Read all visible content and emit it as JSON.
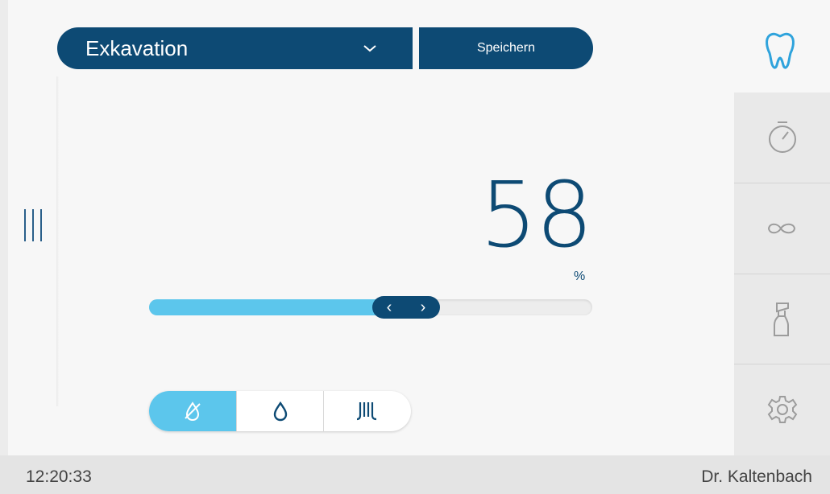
{
  "program": {
    "label": "Exkavation"
  },
  "toolbar": {
    "save_label": "Speichern"
  },
  "motor": {
    "speed_value": "58",
    "speed_unit": "%",
    "speed_fraction": 0.58
  },
  "coolant": {
    "options": [
      "spray-off",
      "water-drop",
      "spray-jets"
    ],
    "selected": "spray-off"
  },
  "sidebar": {
    "items": [
      "stopwatch-icon",
      "infinity-icon",
      "spray-bottle-icon",
      "gear-icon"
    ]
  },
  "status": {
    "time": "12:20:33",
    "user": "Dr. Kaltenbach"
  },
  "colors": {
    "primary": "#0d4a74",
    "accent": "#5cc6ec",
    "sidebar": "#e9e9e9"
  }
}
